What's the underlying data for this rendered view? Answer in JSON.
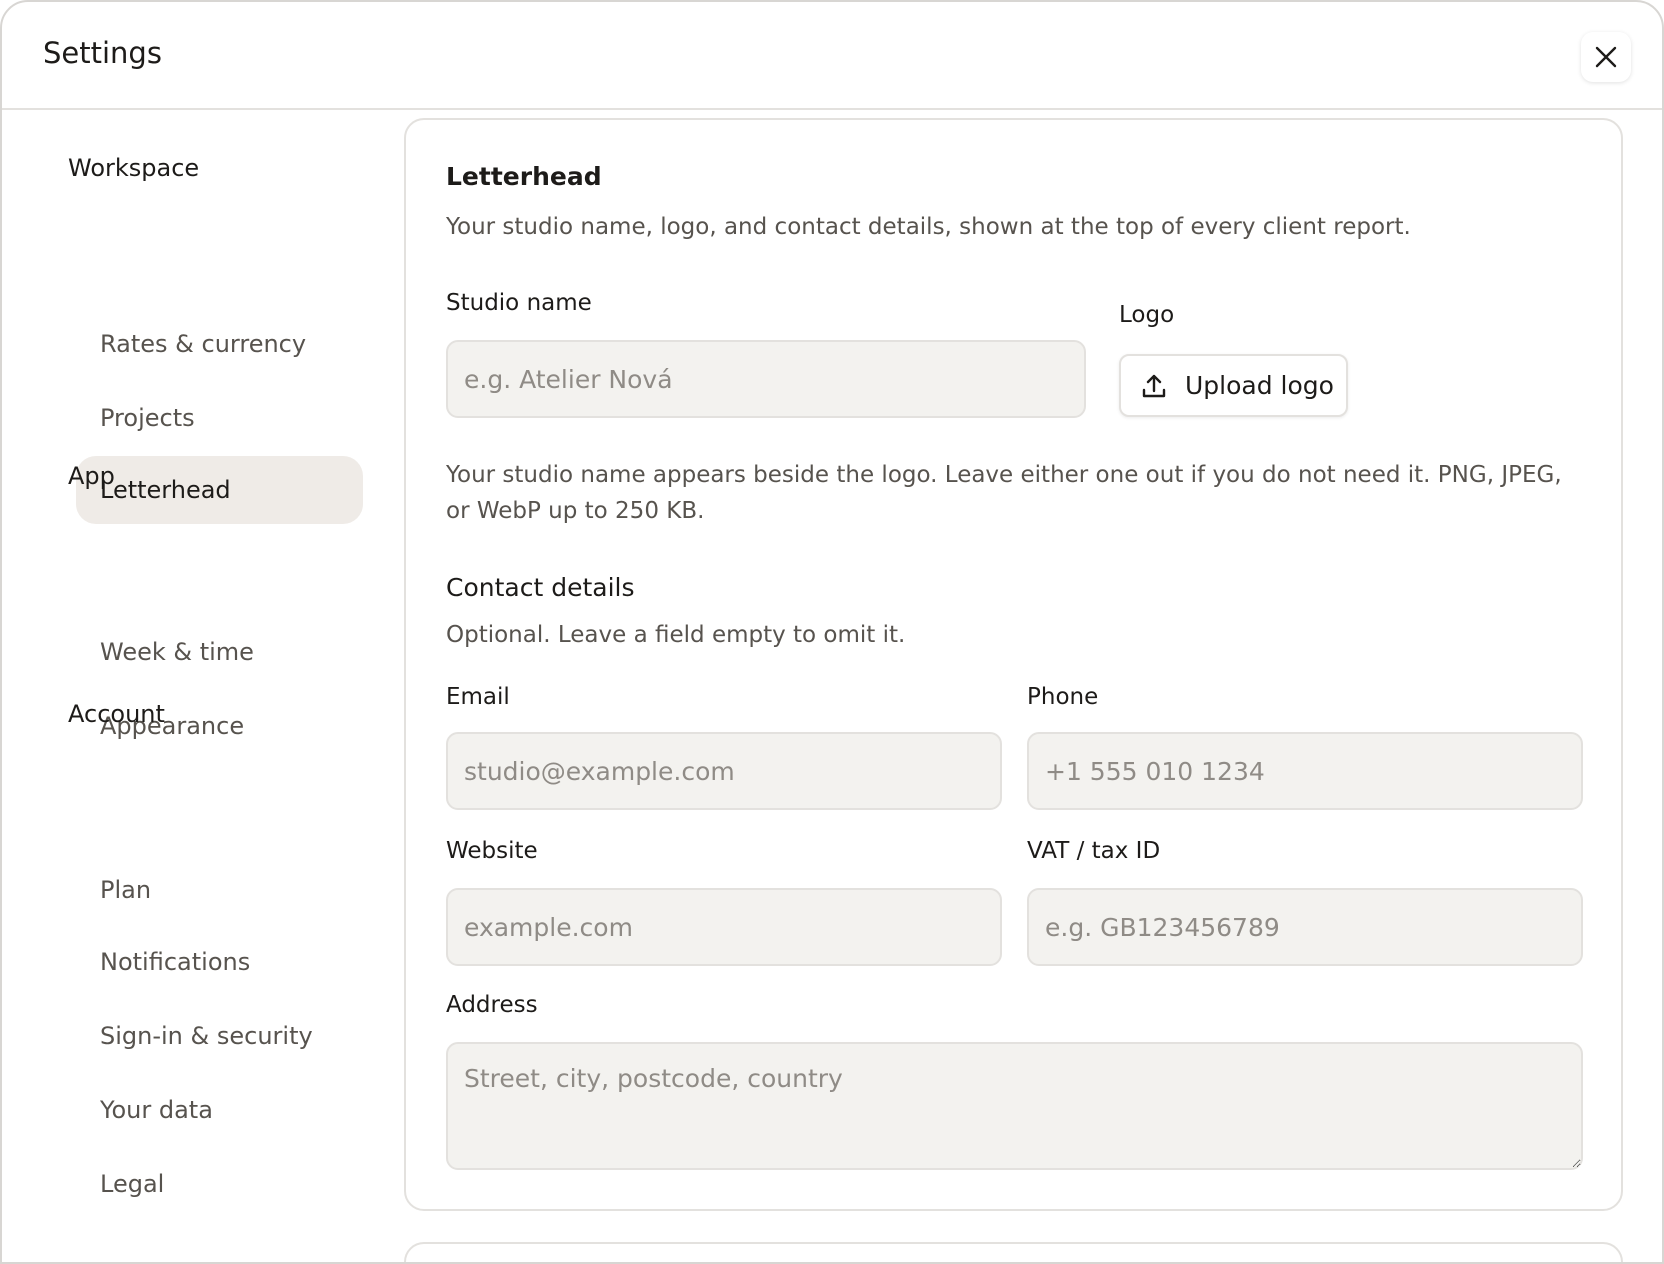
{
  "header": {
    "title": "Settings"
  },
  "sidebar": {
    "groups": [
      {
        "label": "Workspace",
        "items": [
          "Rates & currency",
          "Projects",
          "Letterhead"
        ]
      },
      {
        "label": "App",
        "items": [
          "Week & time",
          "Appearance"
        ]
      },
      {
        "label": "Account",
        "items": [
          "Plan",
          "Notifications",
          "Sign-in & security",
          "Your data",
          "Legal"
        ]
      }
    ],
    "active_item": "Letterhead"
  },
  "letterhead": {
    "title": "Letterhead",
    "description": "Your studio name, logo, and contact details, shown at the top of every client report.",
    "studio_name_label": "Studio name",
    "studio_name_placeholder": "e.g. Atelier Nová",
    "logo_label": "Logo",
    "upload_button": "Upload logo",
    "logo_hint": "Your studio name appears beside the logo. Leave either one out if you do not need it. PNG, JPEG, or WebP up to 250 KB.",
    "contact": {
      "title": "Contact details",
      "description": "Optional. Leave a field empty to omit it.",
      "email_label": "Email",
      "email_placeholder": "studio@example.com",
      "phone_label": "Phone",
      "phone_placeholder": "+1 555 010 1234",
      "website_label": "Website",
      "website_placeholder": "example.com",
      "vat_label": "VAT / tax ID",
      "vat_placeholder": "e.g. GB123456789",
      "address_label": "Address",
      "address_placeholder": "Street, city, postcode, country"
    }
  }
}
